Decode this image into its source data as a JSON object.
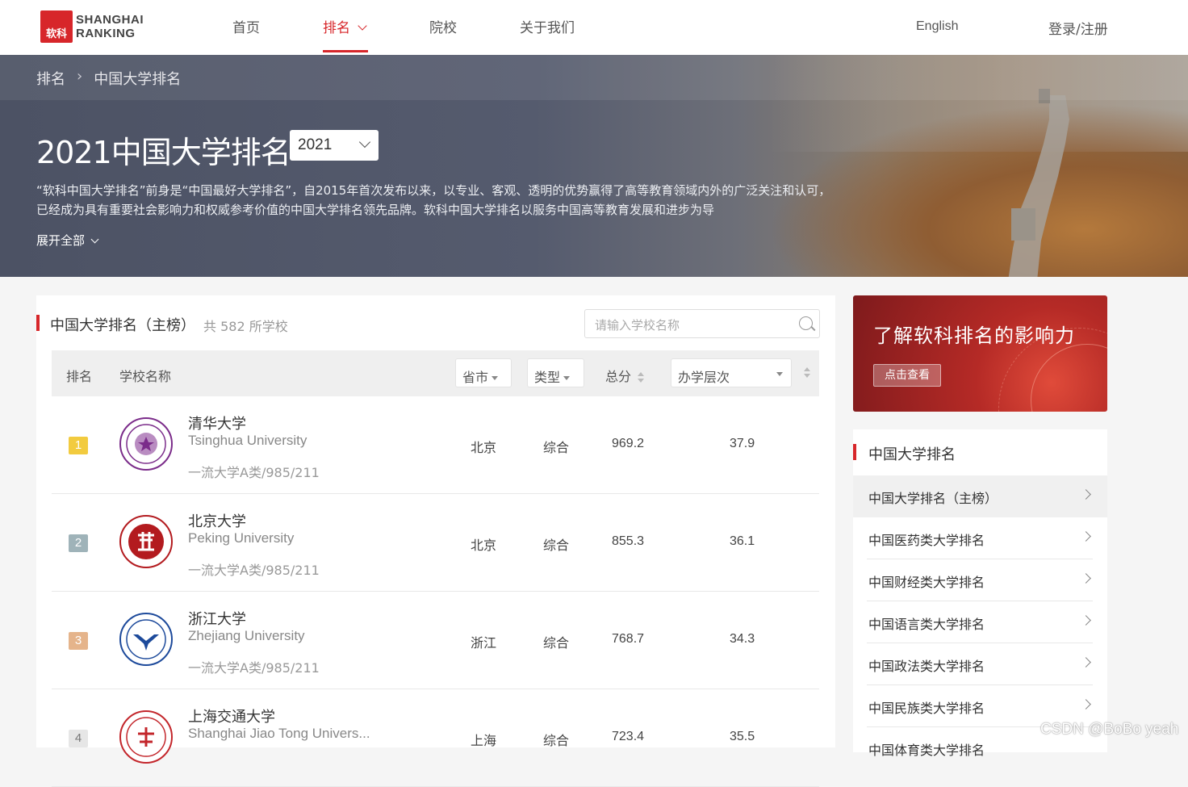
{
  "header": {
    "logo_mark": "软科",
    "logo_line1": "SHANGHAI",
    "logo_line2": "RANKING",
    "nav": [
      "首页",
      "排名",
      "院校",
      "关于我们"
    ],
    "active_nav": "排名",
    "language": "English",
    "login": "登录/注册"
  },
  "banner": {
    "breadcrumb": [
      "排名",
      "中国大学排名"
    ],
    "title": "2021中国大学排名",
    "year": "2021",
    "description": "“软科中国大学排名”前身是“中国最好大学排名”，自2015年首次发布以来，以专业、客观、透明的优势赢得了高等教育领域内外的广泛关注和认可，已经成为具有重要社会影响力和权威参考价值的中国大学排名领先品牌。软科中国大学排名以服务中国高等教育发展和进步为导",
    "expand_label": "展开全部"
  },
  "ranking": {
    "title": "中国大学排名（主榜）",
    "count_text": "共 582 所学校",
    "search_placeholder": "请输入学校名称",
    "columns": {
      "rank": "排名",
      "name": "学校名称",
      "province": "省市",
      "type": "类型",
      "score": "总分",
      "level": "办学层次"
    },
    "rows": [
      {
        "rank": "1",
        "name_cn": "清华大学",
        "name_en": "Tsinghua University",
        "tags": "一流大学A类/985/211",
        "province": "北京",
        "type": "综合",
        "score": "969.2",
        "level": "37.9",
        "rank_color": "#f2cb3f",
        "emblem_color": "#7b2c8a"
      },
      {
        "rank": "2",
        "name_cn": "北京大学",
        "name_en": "Peking University",
        "tags": "一流大学A类/985/211",
        "province": "北京",
        "type": "综合",
        "score": "855.3",
        "level": "36.1",
        "rank_color": "#9fb3b9",
        "emblem_color": "#b31b1f"
      },
      {
        "rank": "3",
        "name_cn": "浙江大学",
        "name_en": "Zhejiang University",
        "tags": "一流大学A类/985/211",
        "province": "浙江",
        "type": "综合",
        "score": "768.7",
        "level": "34.3",
        "rank_color": "#e5b48b",
        "emblem_color": "#1d4a9b"
      },
      {
        "rank": "4",
        "name_cn": "上海交通大学",
        "name_en": "Shanghai Jiao Tong Univers...",
        "tags": "",
        "province": "上海",
        "type": "综合",
        "score": "723.4",
        "level": "35.5",
        "rank_color": "#e6e6e6",
        "emblem_color": "#c3262b"
      }
    ]
  },
  "promo": {
    "title": "了解软科排名的影响力",
    "button": "点击查看"
  },
  "sidebar": {
    "title": "中国大学排名",
    "items": [
      "中国大学排名（主榜）",
      "中国医药类大学排名",
      "中国财经类大学排名",
      "中国语言类大学排名",
      "中国政法类大学排名",
      "中国民族类大学排名",
      "中国体育类大学排名"
    ]
  },
  "watermark": "CSDN @BoBo yeah",
  "colors": {
    "brand_red": "#d7262a"
  }
}
